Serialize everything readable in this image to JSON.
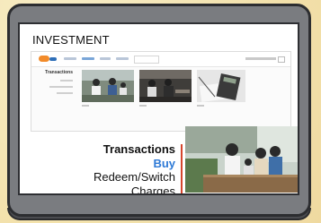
{
  "page": {
    "title": "INVESTMENT"
  },
  "webshot": {
    "sidebar_heading": "Transactions"
  },
  "menu": {
    "heading": "Transactions",
    "items": [
      {
        "label": "Buy",
        "active": true
      },
      {
        "label": "Redeem/Switch",
        "active": false
      },
      {
        "label": "Charges",
        "active": false
      }
    ]
  },
  "colors": {
    "accent": "#2d79d6",
    "divider": "#d6452c",
    "background": "#f5e7b6",
    "device": "#7a7c80"
  }
}
